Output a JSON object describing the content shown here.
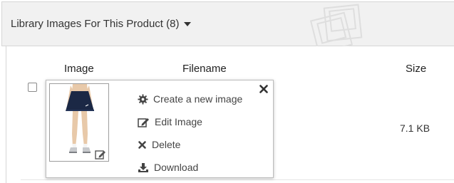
{
  "header": {
    "title": "Library Images For This Product (8)"
  },
  "table": {
    "columns": {
      "image": "Image",
      "filename": "Filename",
      "size": "Size"
    },
    "row": {
      "size": "7.1 KB"
    }
  },
  "popup": {
    "menu": [
      {
        "label": "Create a new image",
        "icon": "gear-icon"
      },
      {
        "label": "Edit Image",
        "icon": "edit-icon"
      },
      {
        "label": "Delete",
        "icon": "close-icon"
      },
      {
        "label": "Download",
        "icon": "download-icon"
      }
    ]
  },
  "colors": {
    "header_bg": "#f1f1f1",
    "border": "#d6d6d6",
    "skirt": "#1b2845",
    "text": "#333333"
  }
}
